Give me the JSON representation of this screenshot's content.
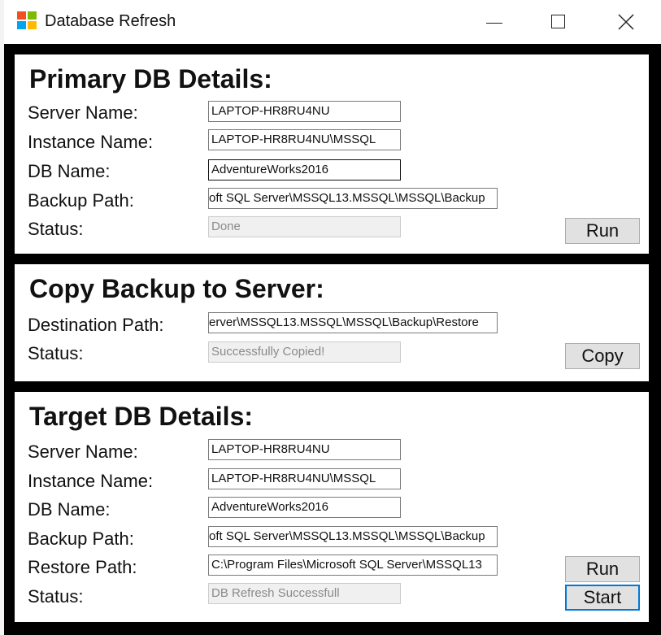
{
  "window": {
    "title": "Database Refresh"
  },
  "primary": {
    "heading": "Primary DB Details:",
    "server_label": "Server Name:",
    "server_value": "LAPTOP-HR8RU4NU",
    "instance_label": "Instance Name:",
    "instance_value": "LAPTOP-HR8RU4NU\\MSSQL",
    "db_label": "DB Name:",
    "db_value": "AdventureWorks2016",
    "backup_label": "Backup Path:",
    "backup_value": "oft SQL Server\\MSSQL13.MSSQL\\MSSQL\\Backup",
    "status_label": "Status:",
    "status_value": "Done",
    "run_button": "Run"
  },
  "copy": {
    "heading": "Copy Backup to Server:",
    "dest_label": "Destination Path:",
    "dest_value": "erver\\MSSQL13.MSSQL\\MSSQL\\Backup\\Restore",
    "status_label": "Status:",
    "status_value": "Successfully Copied!",
    "copy_button": "Copy"
  },
  "target": {
    "heading": "Target DB Details:",
    "server_label": "Server Name:",
    "server_value": "LAPTOP-HR8RU4NU",
    "instance_label": "Instance Name:",
    "instance_value": "LAPTOP-HR8RU4NU\\MSSQL",
    "db_label": "DB Name:",
    "db_value": "AdventureWorks2016",
    "backup_label": "Backup Path:",
    "backup_value": "oft SQL Server\\MSSQL13.MSSQL\\MSSQL\\Backup",
    "restore_label": "Restore Path:",
    "restore_value": "C:\\Program Files\\Microsoft SQL Server\\MSSQL13",
    "status_label": "Status:",
    "status_value": "DB Refresh Successfull",
    "run_button": "Run",
    "start_button": "Start"
  }
}
